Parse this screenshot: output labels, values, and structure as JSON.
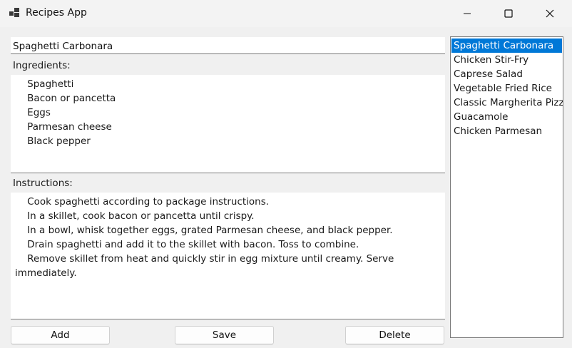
{
  "window": {
    "title": "Recipes App"
  },
  "recipe": {
    "name": "Spaghetti Carbonara",
    "ingredients_label": "Ingredients:",
    "ingredients": [
      "Spaghetti",
      "Bacon or pancetta",
      "Eggs",
      "Parmesan cheese",
      "Black pepper"
    ],
    "instructions_label": "Instructions:",
    "instructions": [
      "Cook spaghetti according to package instructions.",
      "In a skillet, cook bacon or pancetta until crispy.",
      "In a bowl, whisk together eggs, grated Parmesan cheese, and black pepper.",
      "Drain spaghetti and add it to the skillet with bacon. Toss to combine.",
      "Remove skillet from heat and quickly stir in egg mixture until creamy. Serve immediately."
    ]
  },
  "recipe_list": {
    "items": [
      "Spaghetti Carbonara",
      "Chicken Stir-Fry",
      "Caprese Salad",
      "Vegetable Fried Rice",
      "Classic Margherita Pizza",
      "Guacamole",
      "Chicken Parmesan"
    ],
    "selected": "Spaghetti Carbonara"
  },
  "buttons": {
    "add": "Add",
    "save": "Save",
    "delete": "Delete"
  },
  "icons": {
    "app": "windows-app-icon",
    "minimize": "minimize-icon",
    "maximize": "maximize-icon",
    "close": "close-icon"
  },
  "colors": {
    "selection": "#0078d7"
  }
}
